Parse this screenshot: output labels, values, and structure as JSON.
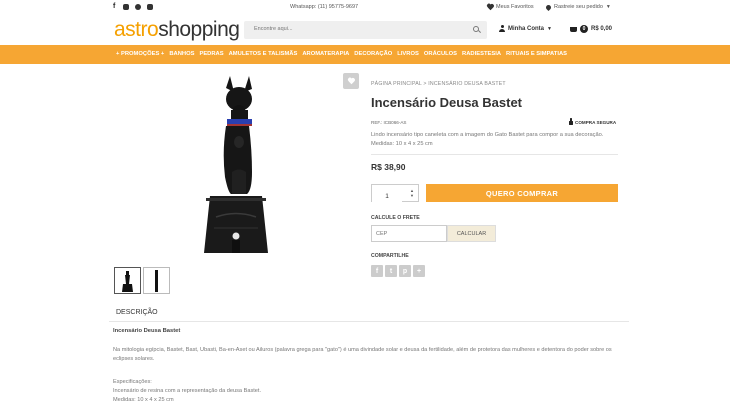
{
  "topbar": {
    "social_icons": [
      "facebook-icon",
      "instagram-icon",
      "pinterest-icon",
      "youtube-icon"
    ],
    "whatsapp": "Whatsapp: (11) 95775-9697",
    "favorites": "Meus Favoritos",
    "track_order": "Rastreie seu pedido"
  },
  "header": {
    "logo_part1": "astro",
    "logo_part2": "shopping",
    "search_placeholder": "Encontre aqui...",
    "account": "Minha Conta",
    "cart_count": "0",
    "cart_total": "R$ 0,00"
  },
  "nav": {
    "items": [
      "+ PROMOÇÕES +",
      "BANHOS",
      "PEDRAS",
      "AMULETOS E TALISMÃS",
      "AROMATERAPIA",
      "DECORAÇÃO",
      "LIVROS",
      "ORÁCULOS",
      "RADIESTESIA",
      "RITUAIS E SIMPATIAS"
    ]
  },
  "product": {
    "breadcrumb": "PÁGINA PRINCIPAL  >  INCENSÁRIO DEUSA BASTET",
    "title": "Incensário Deusa Bastet",
    "ref": "REF.: ICB066-AS",
    "secure": "COMPRA SEGURA",
    "description": "Lindo incensário tipo caneleta com a imagem do Gato Bastet para compor a sua decoração. Medidas: 10 x 4 x 25 cm",
    "price": "R$ 38,90",
    "quantity": "1",
    "buy_label": "QUERO COMPRAR",
    "shipping_label": "CALCULE O FRETE",
    "cep_placeholder": "CEP",
    "calc_label": "CALCULAR",
    "share_label": "COMPARTILHE",
    "share_icons": [
      "facebook-share-icon",
      "twitter-share-icon",
      "pinterest-share-icon",
      "plus-share-icon"
    ]
  },
  "description_section": {
    "tab": "DESCRIÇÃO",
    "title": "Incensário Deusa Bastet",
    "body": "Na mitologia egípcia, Bastet, Bast, Ubasti, Ba-en-Aset ou Ailuros (palavra grega para \"gato\") é uma divindade solar e deusa da fertilidade, além de protetora das mulheres e detentora do poder sobre os eclipses solares.",
    "spec_label": "Especificações:",
    "spec1": "Incensário de resina com a representação da deusa Bastet.",
    "spec2": "Medidas: 10 x 4 x 25 cm"
  },
  "colors": {
    "accent": "#f6a633",
    "logo_orange": "#f5a000"
  }
}
